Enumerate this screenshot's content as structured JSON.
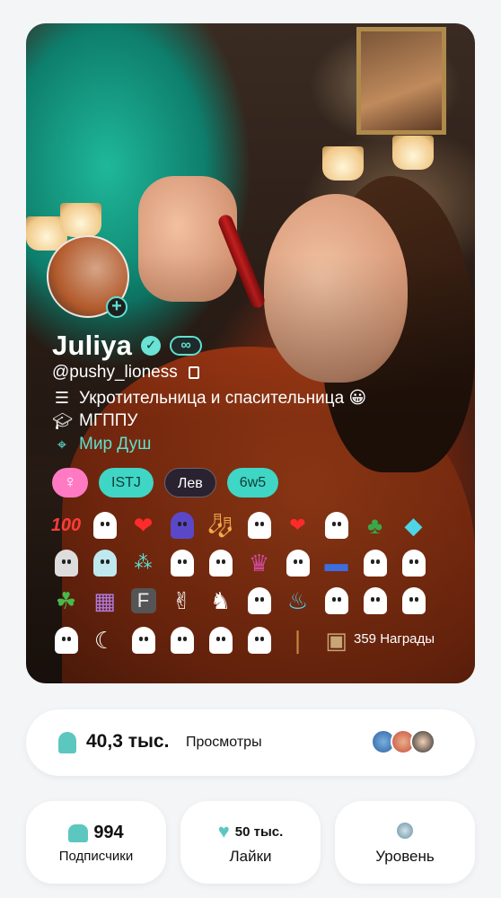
{
  "profile": {
    "name": "Juliya",
    "username": "@pushy_lioness",
    "bio": "Укротительница и спасительница 😀",
    "education": "МГППУ",
    "community": "Мир Душ",
    "icons": {
      "verified": "check-badge-icon",
      "infinity": "infinity-badge-icon",
      "copy": "copy-icon",
      "bio": "layers-icon",
      "education": "graduation-cap-icon",
      "community": "location-pin-icon",
      "add_story": "plus-icon"
    },
    "accent_color": "#5fe0d0"
  },
  "chips": {
    "gender": "♀",
    "mbti": "ISTJ",
    "zodiac": "Лев",
    "enneagram": "6w5",
    "gender_color": "#ff7ac3",
    "teal_color": "#3fd6c6"
  },
  "awards": {
    "label_100": "100",
    "count_label": "359 Награды"
  },
  "views": {
    "value": "40,3 тыс.",
    "label": "Просмотры"
  },
  "stats": {
    "subscribers_value": "994",
    "subscribers_label": "Подписчики",
    "likes_value": "50 тыс.",
    "likes_label": "Лайки",
    "level_label": "Уровень"
  }
}
